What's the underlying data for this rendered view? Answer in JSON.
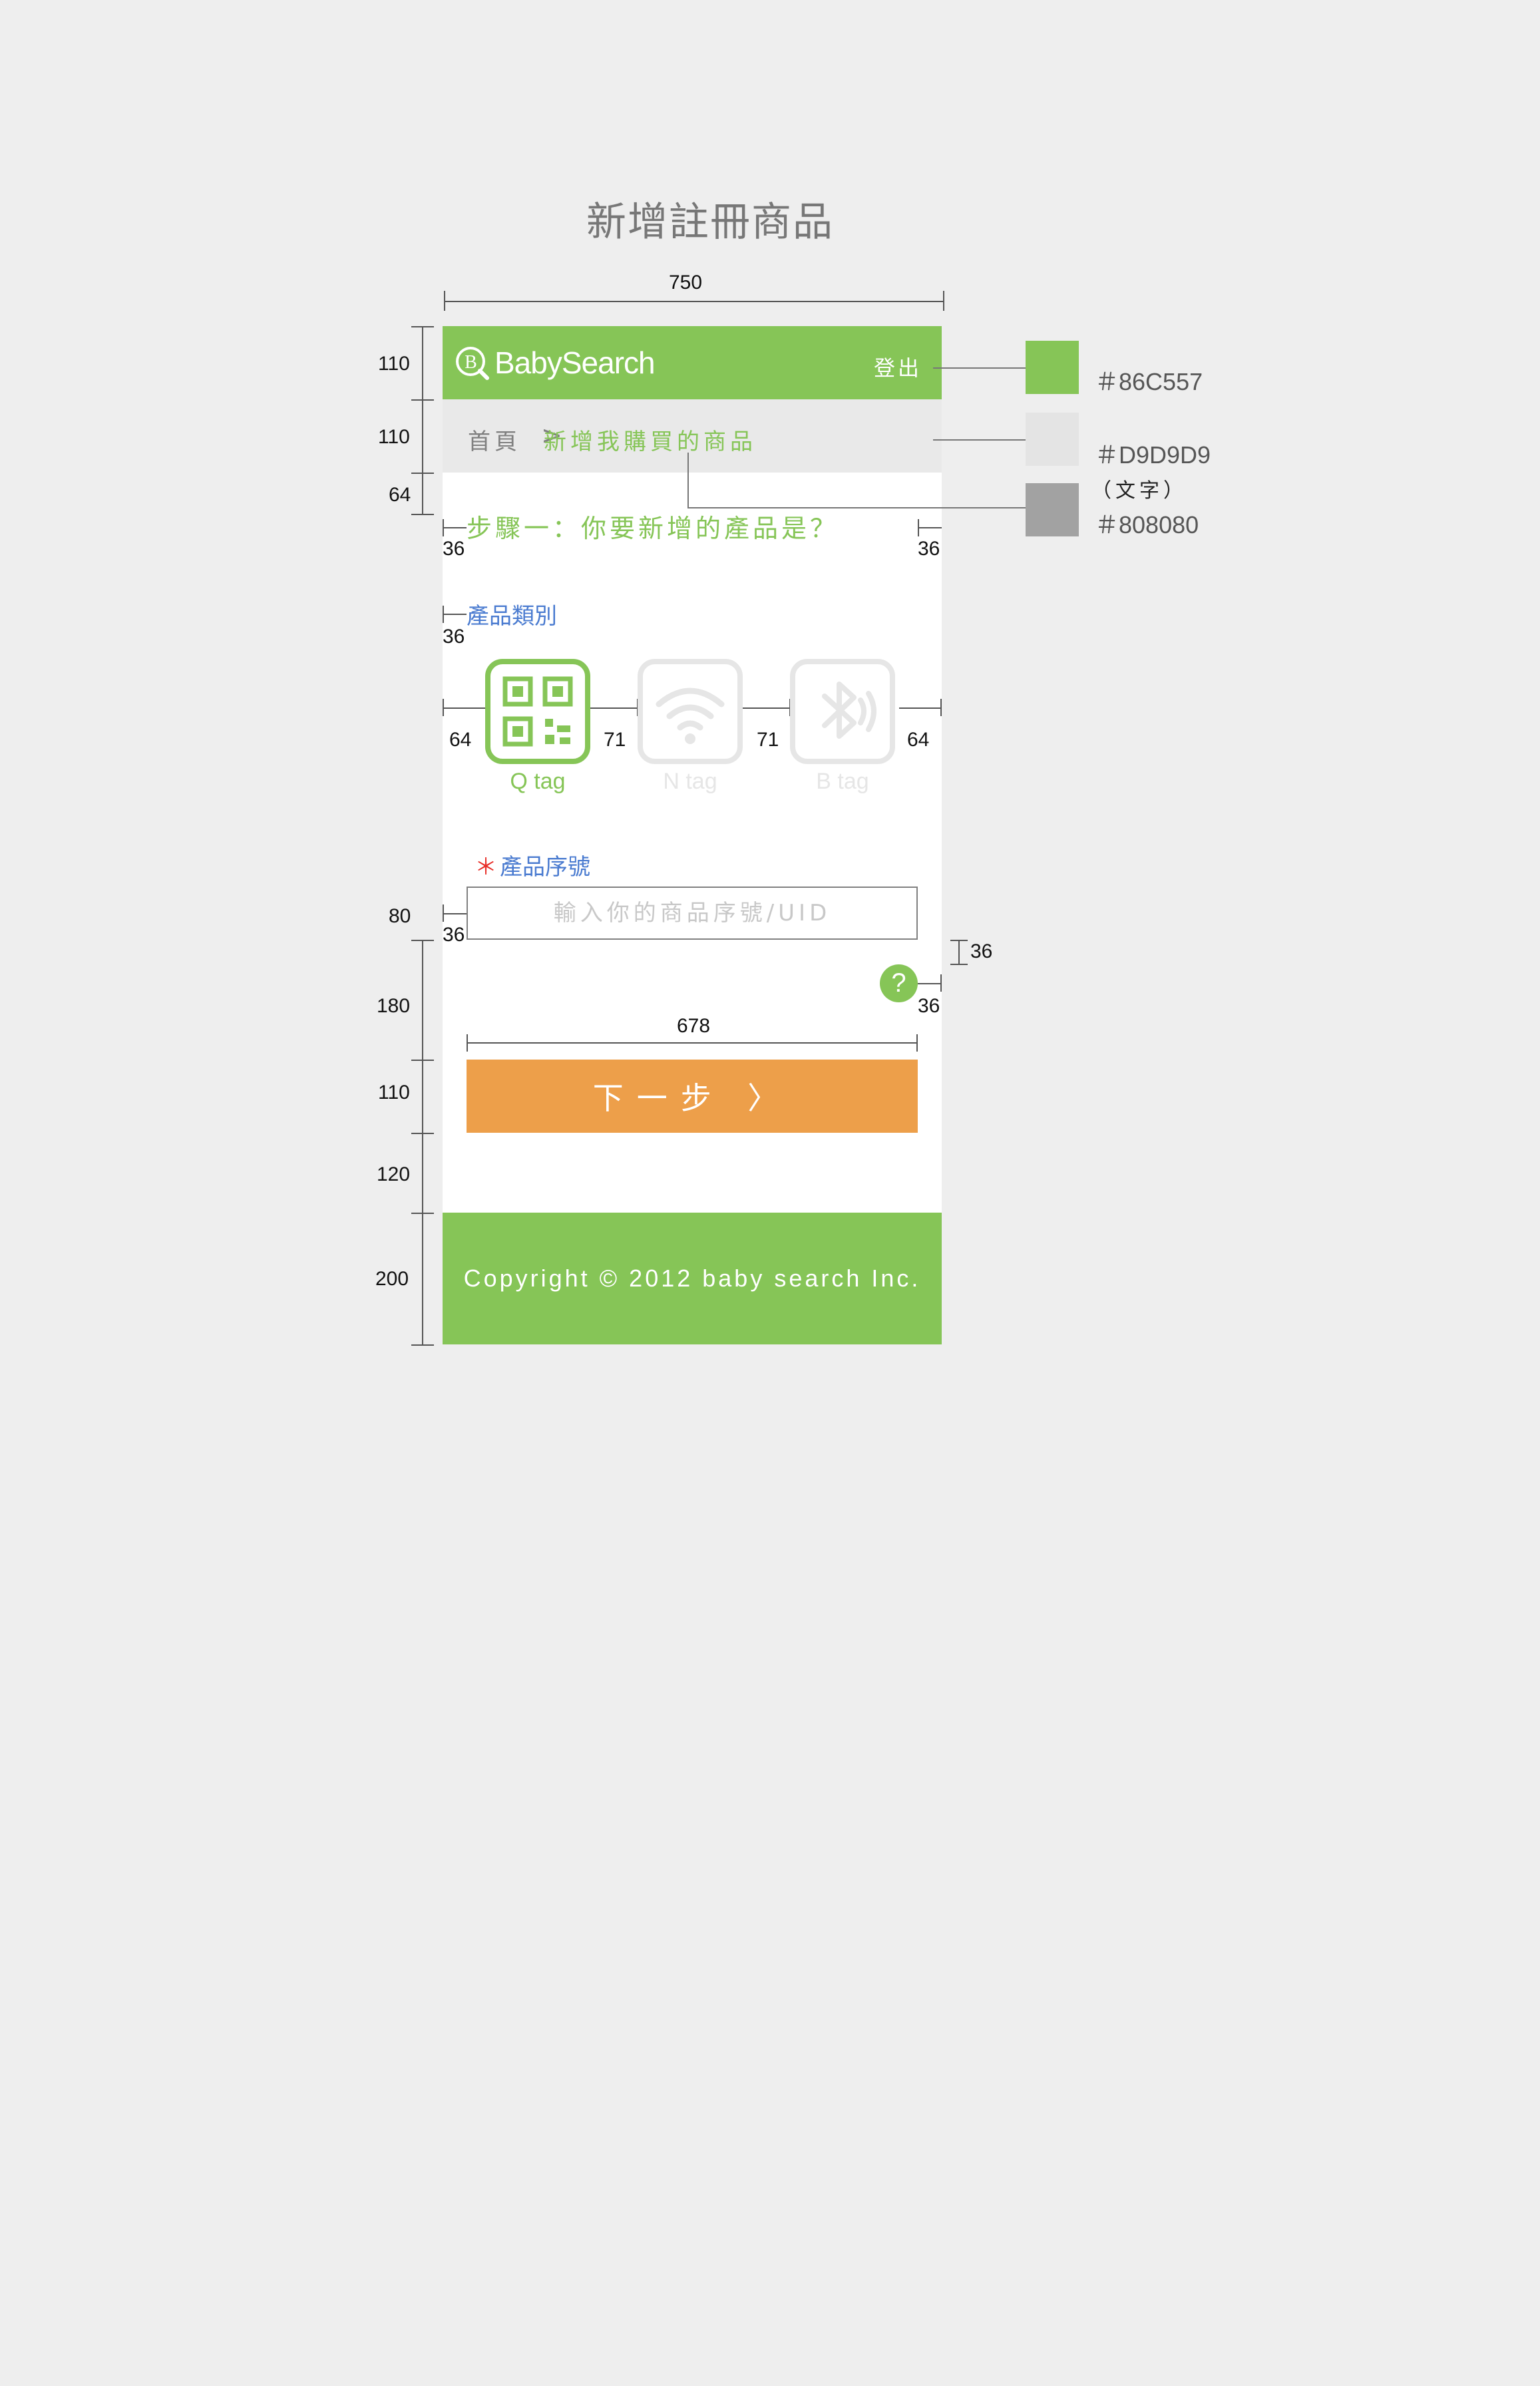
{
  "spec": {
    "title": "新增註冊商品",
    "dim_width": "750",
    "dim_button_width": "678",
    "dim_header": "110",
    "dim_crumb": "110",
    "dim_step_gap": "64",
    "dim_input": "80",
    "dim_help_gap": "180",
    "dim_button": "110",
    "dim_after_button": "120",
    "dim_footer": "200",
    "dim_margin": "36",
    "dim_tag_edge": "64",
    "dim_tag_gap": "71"
  },
  "header": {
    "brand": "BabySearch",
    "logout_label": "登出"
  },
  "breadcrumb": {
    "home": "首頁",
    "separator": ">",
    "current": "新增我購買的商品"
  },
  "step_title": "步驟一：你要新增的產品是？",
  "category": {
    "label": "產品類別",
    "tags": [
      {
        "label": "Q tag",
        "icon": "qr-code-icon",
        "selected": true
      },
      {
        "label": "N tag",
        "icon": "wifi-icon",
        "selected": false
      },
      {
        "label": "B tag",
        "icon": "bluetooth-icon",
        "selected": false
      }
    ]
  },
  "serial": {
    "required_mark": "＊",
    "label": "產品序號",
    "placeholder": "輸入你的商品序號/UID",
    "value": ""
  },
  "help_label": "?",
  "next_button": "下一步 〉",
  "footer": "Copyright © 2012 baby search Inc.",
  "palette": [
    {
      "hex": "#86C557",
      "label": "＃86C557",
      "note": ""
    },
    {
      "hex": "#D9D9D9",
      "label": "＃D9D9D9",
      "note": "（文字）"
    },
    {
      "hex": "#A2A2A2",
      "label": "＃808080",
      "note": ""
    }
  ],
  "colors": {
    "green": "#86C557",
    "crumb_bg": "#E9E9E9",
    "text_gray": "#808080",
    "inactive": "#E6E6E6",
    "orange": "#ED9F4A",
    "link_blue": "#4A7BD0",
    "required_red": "#E8302A"
  }
}
